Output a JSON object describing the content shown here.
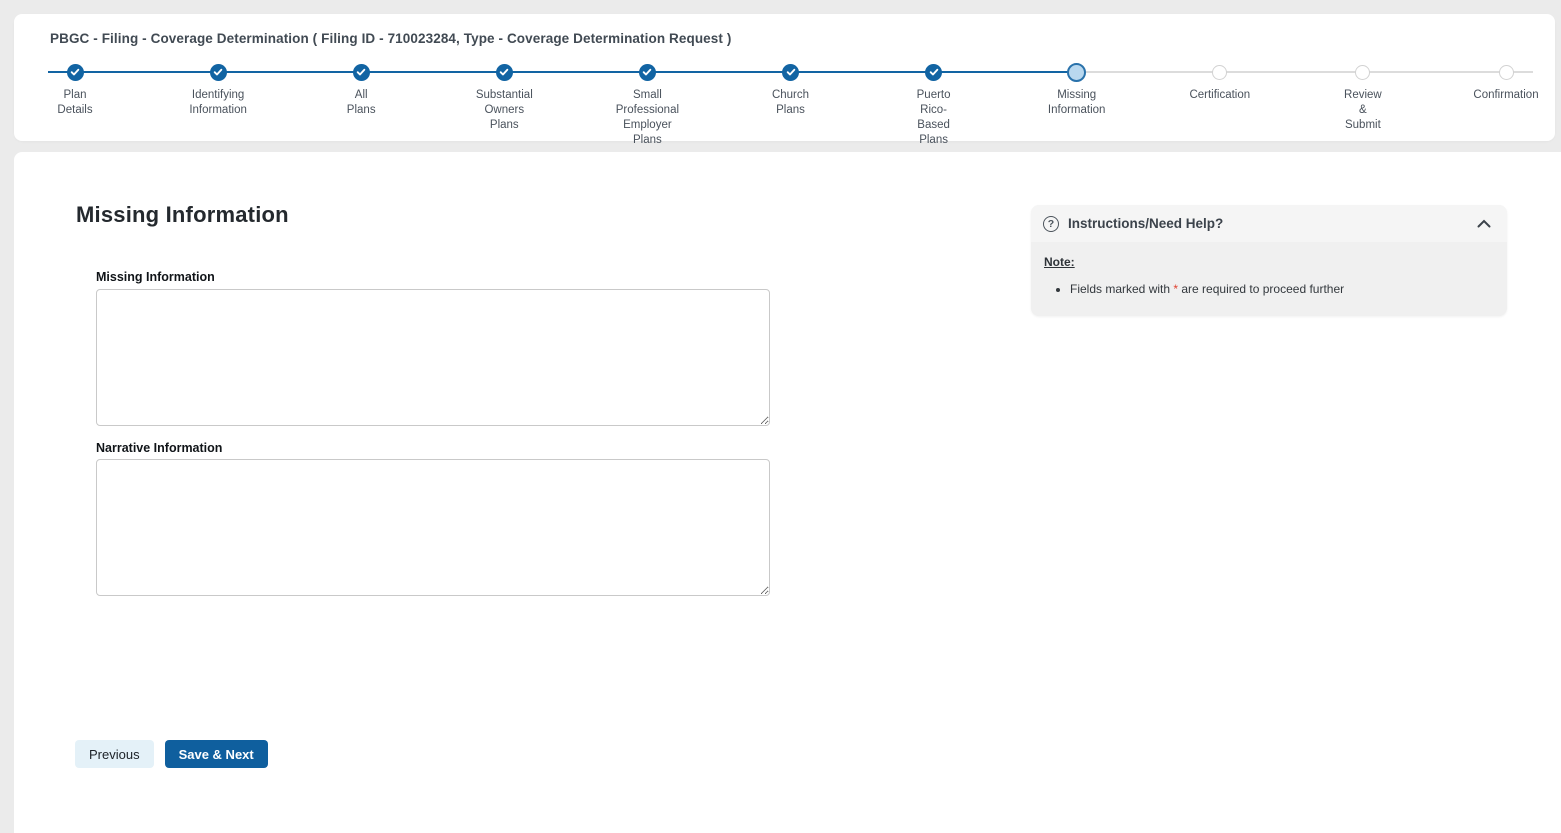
{
  "colors": {
    "accent": "#1264a3",
    "current_step_fill": "#b9d8ef",
    "inactive_gray": "#dcdcdc",
    "save_button": "#0f5f9e",
    "previous_button": "#e4f1f8",
    "required_star": "#e0412f",
    "page_background": "#ebebeb"
  },
  "window": {
    "title": "PBGC - Filing - Coverage Determination ( Filing ID - 710023284, Type - Coverage Determination Request )"
  },
  "stepper": {
    "steps": [
      {
        "label_lines": [
          "Plan",
          "Details"
        ],
        "state": "complete"
      },
      {
        "label_lines": [
          "Identifying",
          "Information"
        ],
        "state": "complete"
      },
      {
        "label_lines": [
          "All",
          "Plans"
        ],
        "state": "complete"
      },
      {
        "label_lines": [
          "Substantial",
          "Owners",
          "Plans"
        ],
        "state": "complete"
      },
      {
        "label_lines": [
          "Small",
          "Professional",
          "Employer",
          "Plans"
        ],
        "state": "complete"
      },
      {
        "label_lines": [
          "Church",
          "Plans"
        ],
        "state": "complete"
      },
      {
        "label_lines": [
          "Puerto",
          "Rico-",
          "Based",
          "Plans"
        ],
        "state": "complete"
      },
      {
        "label_lines": [
          "Missing",
          "Information"
        ],
        "state": "current"
      },
      {
        "label_lines": [
          "Certification"
        ],
        "state": "future"
      },
      {
        "label_lines": [
          "Review",
          "&",
          "Submit"
        ],
        "state": "future"
      },
      {
        "label_lines": [
          "Confirmation"
        ],
        "state": "future"
      }
    ]
  },
  "main": {
    "heading": "Missing Information",
    "fields": [
      {
        "label": "Missing Information",
        "value": ""
      },
      {
        "label": "Narrative Information",
        "value": ""
      }
    ],
    "buttons": {
      "previous": "Previous",
      "save_next": "Save & Next"
    }
  },
  "help_panel": {
    "icon_glyph": "?",
    "title": "Instructions/Need Help?",
    "collapse_icon": "chevron-up",
    "note_label": "Note:",
    "bullet": {
      "prefix": "Fields marked with ",
      "star": "*",
      "suffix": " are required to proceed further"
    }
  }
}
